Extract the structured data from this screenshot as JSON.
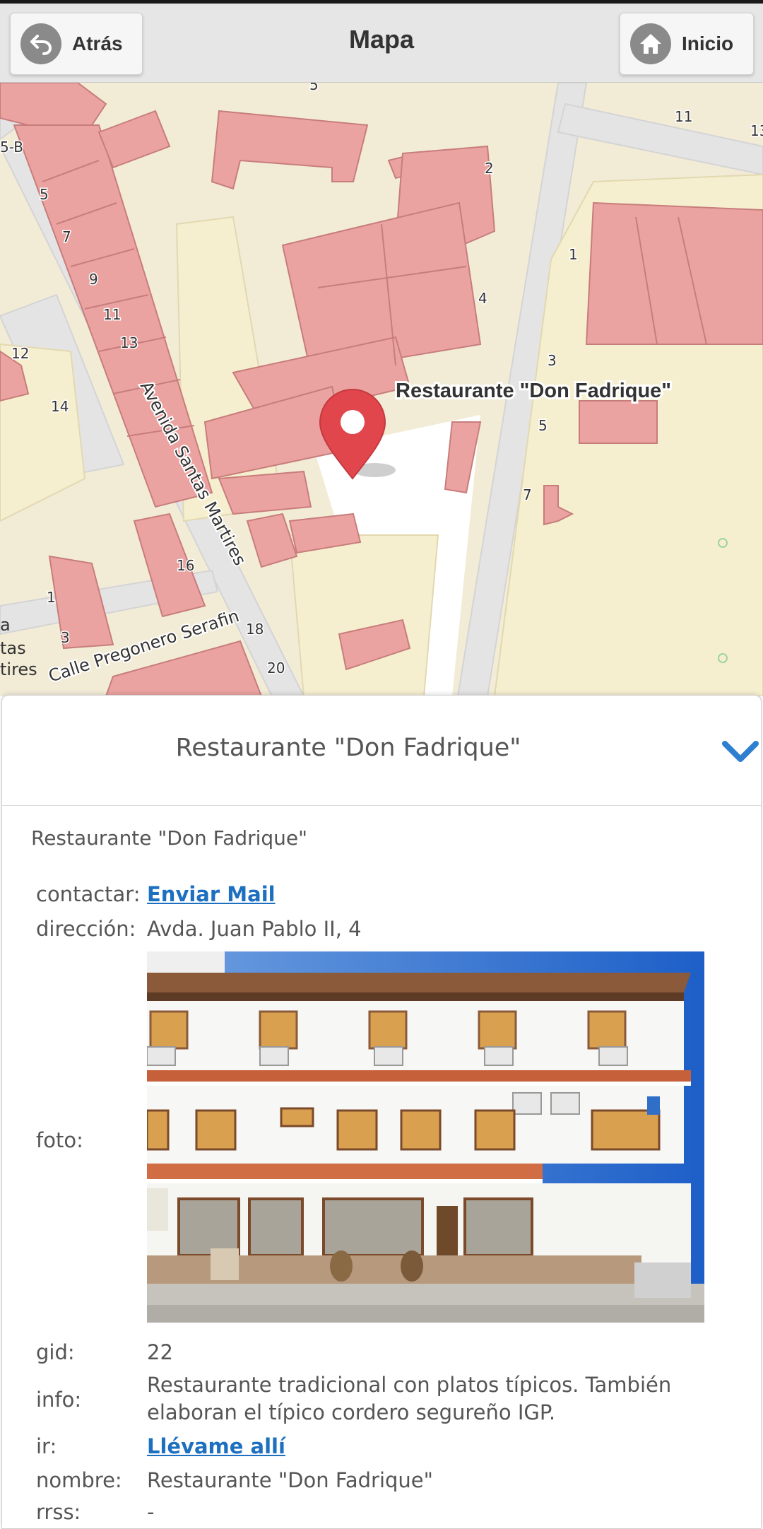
{
  "header": {
    "title": "Mapa",
    "back_label": "Atrás",
    "home_label": "Inicio"
  },
  "map": {
    "streets": [
      "Avenida Santas Martires",
      "Calle Pregonero Serafin"
    ],
    "marker_label": "Restaurante \"Don Fadrique\"",
    "house_numbers": [
      "11",
      "5-B",
      "5",
      "7",
      "9",
      "11",
      "13",
      "12",
      "14",
      "16",
      "2",
      "4",
      "1",
      "3",
      "5",
      "7",
      "1",
      "3",
      "18",
      "20",
      "5",
      "13"
    ],
    "edge_text": [
      "a",
      "tas",
      "tires"
    ]
  },
  "panel": {
    "title": "Restaurante \"Don Fadrique\"",
    "description": "Restaurante \"Don Fadrique\"",
    "fields": {
      "contactar": {
        "label": "contactar:",
        "value": "Enviar Mail"
      },
      "direccion": {
        "label": "dirección:",
        "value": "Avda. Juan Pablo II, 4"
      },
      "foto": {
        "label": "foto:"
      },
      "gid": {
        "label": "gid:",
        "value": "22"
      },
      "info": {
        "label": "info:",
        "line1": "Restaurante tradicional con platos típicos. También",
        "line2": "elaboran el típico cordero segureño IGP."
      },
      "ir": {
        "label": "ir:",
        "value": "Llévame allí"
      },
      "nombre": {
        "label": "nombre:",
        "value": "Restaurante \"Don Fadrique\""
      },
      "rrss": {
        "label": "rrss:",
        "value": "-"
      }
    }
  },
  "colors": {
    "building": "#eba3a1",
    "building_edge": "#c77d7b",
    "ground": "#f2ecd7",
    "road": "#e4e4e4",
    "marker": "#e0464b",
    "link": "#1d6fbf"
  }
}
